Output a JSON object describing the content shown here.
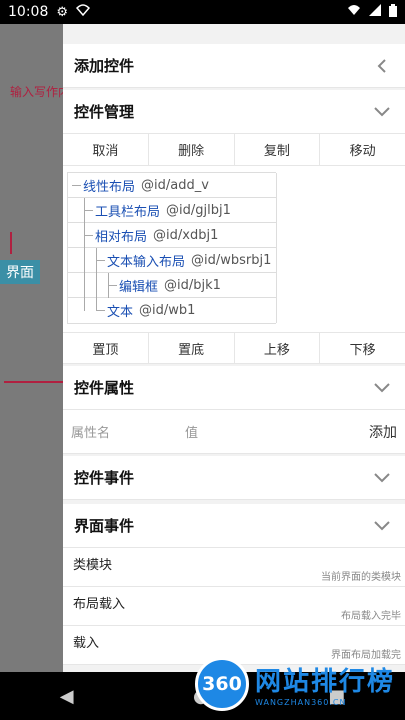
{
  "status_bar": {
    "time": "10:08"
  },
  "left_strip": {
    "hint": "输入写作内",
    "tag": "界面"
  },
  "sections": {
    "add_control": "添加控件",
    "control_manage": "控件管理",
    "control_props": "控件属性",
    "control_events": "控件事件",
    "ui_events": "界面事件"
  },
  "manage_buttons": [
    "取消",
    "删除",
    "复制",
    "移动"
  ],
  "order_buttons": [
    "置顶",
    "置底",
    "上移",
    "下移"
  ],
  "tree": [
    {
      "name": "线性布局",
      "id": "@id/add_v"
    },
    {
      "name": "工具栏布局",
      "id": "@id/gjlbj1"
    },
    {
      "name": "相对布局",
      "id": "@id/xdbj1"
    },
    {
      "name": "文本输入布局",
      "id": "@id/wbsrbj1"
    },
    {
      "name": "编辑框",
      "id": "@id/bjk1"
    },
    {
      "name": "文本",
      "id": "@id/wb1"
    }
  ],
  "props": {
    "name_placeholder": "属性名",
    "value_placeholder": "值",
    "add": "添加"
  },
  "ui_event_items": [
    {
      "label": "类模块",
      "note": "当前界面的类模块"
    },
    {
      "label": "布局载入",
      "note": "布局载入完毕"
    },
    {
      "label": "载入",
      "note": "界面布局加载完"
    }
  ],
  "watermark": {
    "logo": "360",
    "big": "网站排行榜",
    "small": "WANGZHAN360.CN"
  },
  "icons": {
    "settings": "gear-icon",
    "wifi": "wifi-icon",
    "signal": "signal-icon",
    "battery": "battery-icon"
  }
}
